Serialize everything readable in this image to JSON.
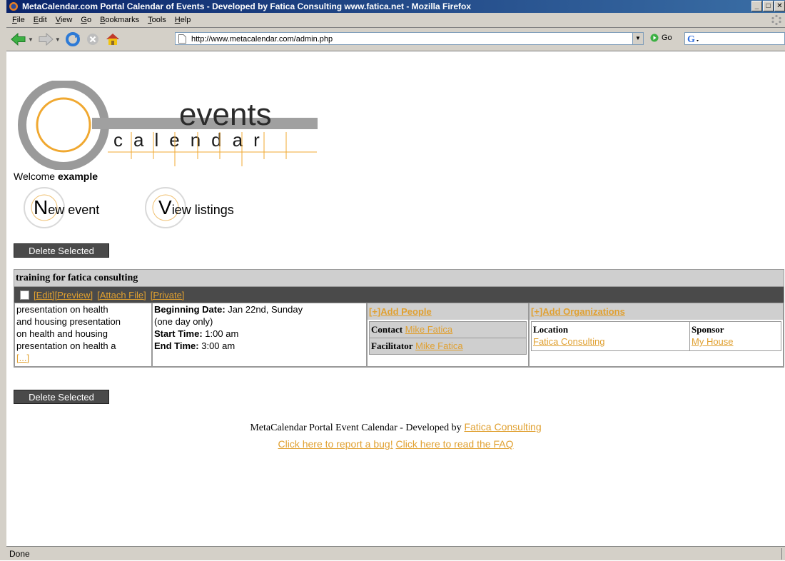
{
  "window": {
    "title": "MetaCalendar.com Portal Calendar of Events - Developed by Fatica Consulting www.fatica.net - Mozilla Firefox"
  },
  "menu": [
    "File",
    "Edit",
    "View",
    "Go",
    "Bookmarks",
    "Tools",
    "Help"
  ],
  "toolbar": {
    "url": "http://www.metacalendar.com/admin.php",
    "go_label": "Go"
  },
  "page": {
    "logo_word_top": "events",
    "logo_word_bottom": "calendar",
    "welcome_prefix": "Welcome",
    "welcome_user": "example",
    "new_event_letter": "N",
    "new_event_rest": "ew event",
    "view_listings_letter": "V",
    "view_listings_rest": "iew listings",
    "delete_selected": "Delete Selected",
    "event": {
      "title": "training for fatica consulting",
      "actions": [
        "[Edit]",
        "[Preview]",
        "[Attach File]",
        "[Private]"
      ],
      "description_lines": [
        "presentation on health",
        "and housing presentation",
        "on health and housing",
        "presentation on health a"
      ],
      "more": "[...]",
      "beginning_date_label": "Beginning Date:",
      "beginning_date": "Jan 22nd, Sunday",
      "duration": "(one day only)",
      "start_time_label": "Start Time:",
      "start_time": "1:00 am",
      "end_time_label": "End Time:",
      "end_time": "3:00 am",
      "add_people": "[+]Add People",
      "contact_label": "Contact",
      "contact": "Mike Fatica",
      "facilitator_label": "Facilitator",
      "facilitator": "Mike Fatica",
      "add_organizations": "[+]Add Organizations",
      "location_label": "Location",
      "location": "Fatica Consulting",
      "sponsor_label": "Sponsor",
      "sponsor": "My House"
    },
    "footer": {
      "text": "MetaCalendar Portal Event Calendar - Developed by",
      "link": "Fatica Consulting",
      "bug_link": "Click here to report a bug!",
      "faq_link": "Click here to read the FAQ"
    }
  },
  "status": "Done",
  "colors": {
    "link": "#e0a030",
    "title_bar": "#0a246a",
    "chrome": "#d4d0c8",
    "dark_bar": "#4a4a4a"
  }
}
